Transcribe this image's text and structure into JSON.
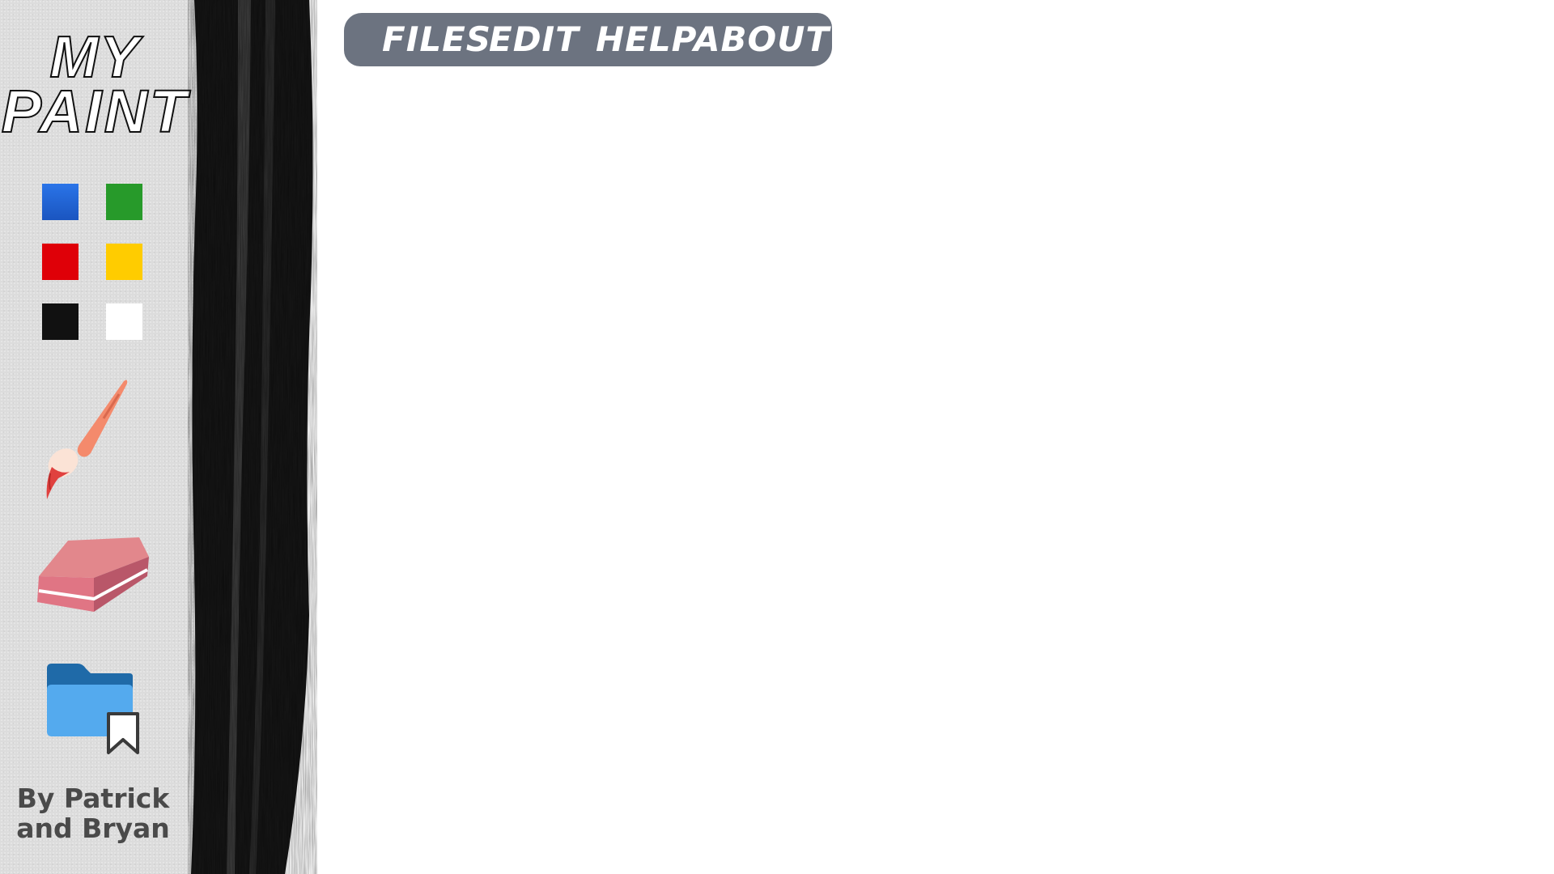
{
  "app": {
    "title_line1": "MY",
    "title_line2": "PAINT",
    "credit": "By Patrick and Bryan"
  },
  "menu": {
    "items": [
      {
        "label": "FILES"
      },
      {
        "label": "EDIT"
      },
      {
        "label": "HELP"
      },
      {
        "label": "ABOUT"
      }
    ]
  },
  "palette": {
    "colors": [
      {
        "name": "blue",
        "hex": "#1f66d6"
      },
      {
        "name": "green",
        "hex": "#279a2a"
      },
      {
        "name": "red",
        "hex": "#df0008"
      },
      {
        "name": "yellow",
        "hex": "#ffcc00"
      },
      {
        "name": "black",
        "hex": "#111111"
      },
      {
        "name": "white",
        "hex": "#ffffff"
      }
    ]
  },
  "tools": {
    "items": [
      {
        "icon": "paintbrush-icon"
      },
      {
        "icon": "eraser-icon"
      },
      {
        "icon": "folder-bookmark-icon"
      }
    ]
  },
  "theme": {
    "sidebar_bg": "#dcdcdc",
    "menubar_bg": "#6c7380",
    "canvas_bg": "#ffffff"
  }
}
